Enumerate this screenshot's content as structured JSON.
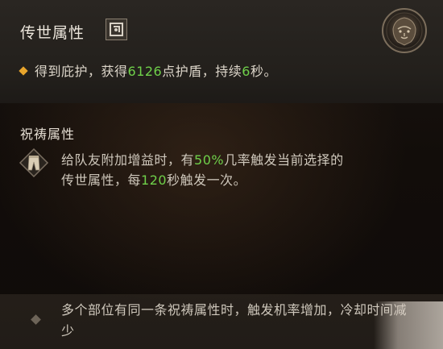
{
  "legendary": {
    "title": "传世属性",
    "effect": {
      "prefix": "得到庇护，获得",
      "shield_amount": "6126",
      "middle": "点护盾，持续",
      "duration": "6",
      "suffix": "秒。"
    }
  },
  "aspect": {
    "title": "祝祷属性",
    "description": {
      "line1_prefix": "给队友附加增益时，有",
      "chance": "50%",
      "line1_suffix": "几率触发当前选择的",
      "line2_prefix": "传世属性，每",
      "cooldown": "120",
      "line2_suffix": "秒触发一次。"
    }
  },
  "note": {
    "text": "多个部位有同一条祝祷属性时，触发机率增加，冷却时间减少"
  },
  "colors": {
    "highlight_green": "#6fd04a",
    "bullet_gold": "#e8a52c"
  },
  "icons": {
    "legendary_badge": "legendary-rune-icon",
    "emblem": "lion-crest-icon",
    "aspect_icon": "pants-icon"
  }
}
